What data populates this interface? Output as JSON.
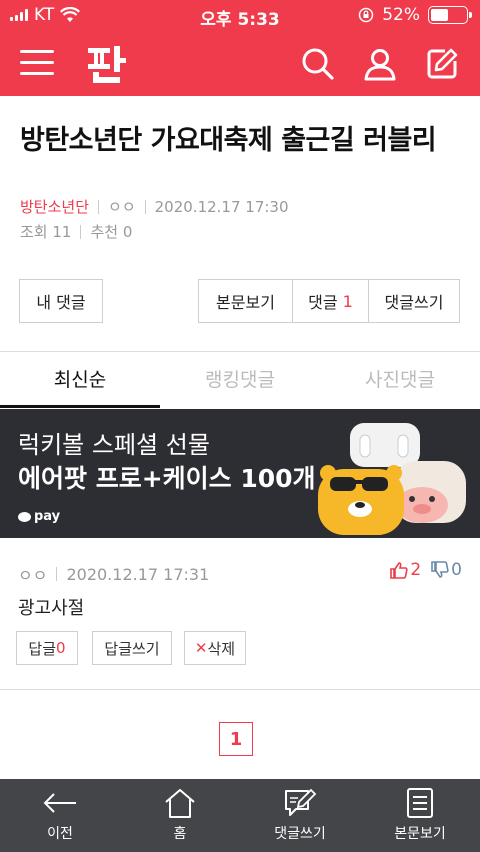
{
  "status_bar": {
    "carrier": "KT",
    "time": "오후 5:33",
    "battery": "52%",
    "battery_level": 0.52
  },
  "article": {
    "title": "방탄소년단 가요대축제 출근길 러블리",
    "category": "방탄소년단",
    "author": "ㅇㅇ",
    "datetime": "2020.12.17 17:30",
    "views": "조회 11",
    "recommend": "추천 0"
  },
  "actions": {
    "my_comments": "내 댓글",
    "view_body": "본문보기",
    "comments_label": "댓글",
    "comments_count": "1",
    "write_comment": "댓글쓰기"
  },
  "tabs": [
    "최신순",
    "랭킹댓글",
    "사진댓글"
  ],
  "ad": {
    "line1": "럭키볼 스페셜 선물",
    "line2": "에어팟 프로+케이스 100개",
    "pay_label": "pay"
  },
  "comment": {
    "author": "ㅇㅇ",
    "datetime": "2020.12.17 17:31",
    "likes": "2",
    "dislikes": "0",
    "text": "광고사절",
    "reply_label": "답글",
    "reply_count": "0",
    "write_reply": "답글쓰기",
    "delete_mark": "✕",
    "delete_label": "삭제"
  },
  "pagination": {
    "current": "1"
  },
  "bottom_nav": [
    {
      "label": "이전",
      "icon": "back-arrow-icon"
    },
    {
      "label": "홈",
      "icon": "home-icon"
    },
    {
      "label": "댓글쓰기",
      "icon": "write-comment-icon"
    },
    {
      "label": "본문보기",
      "icon": "document-icon"
    }
  ],
  "colors": {
    "accent": "#ef3b4b",
    "nav_bg": "#444548",
    "ad_bg": "#2d2e33"
  }
}
